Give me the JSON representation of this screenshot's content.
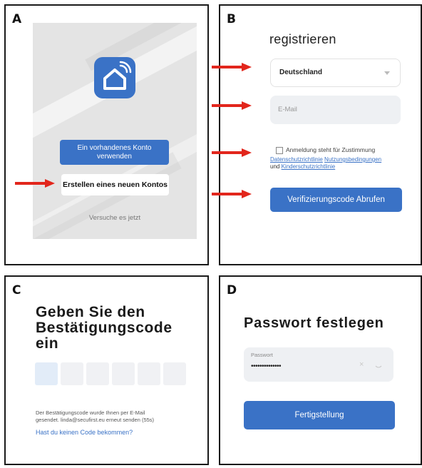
{
  "panels": {
    "a": {
      "label": "A",
      "existing_account_button": [
        "Ein vorhandenes Konto",
        "verwenden"
      ],
      "create_account_button": "Erstellen eines neuen Kontos",
      "try_now_link": "Versuche es jetzt"
    },
    "b": {
      "label": "B",
      "title": "registrieren",
      "country_select": "Deutschland",
      "email_placeholder": "E-Mail",
      "consent_text": "Anmeldung steht für Zustimmung",
      "privacy_link": "Datenschutzrichtlinie",
      "terms_link": "Nutzungsbedingungen",
      "and_text": "und",
      "child_privacy_link": "Kinderschutzrichtlinie",
      "get_code_button": "Verifizierungscode Abrufen"
    },
    "c": {
      "label": "C",
      "title": [
        "Geben Sie den",
        "Bestätigungscode",
        "ein"
      ],
      "code_box_count": 6,
      "info_text": [
        "Der Bestätigungscode wurde Ihnen per E-Mail",
        "gesendet. linda@secufirst.eu erneut senden (55s)"
      ],
      "no_code_link": "Hast du keinen Code bekommen?"
    },
    "d": {
      "label": "D",
      "title": "Passwort festlegen",
      "password_label": "Passwort",
      "password_value": "••••••••••••••",
      "finish_button": "Fertigstellung"
    }
  },
  "colors": {
    "accent_blue": "#3a72c6",
    "arrow_red": "#e2261c",
    "panel_border": "#1a1a1a"
  },
  "icons": {
    "arrow": "red-arrow-icon",
    "app": "smart-home-icon",
    "clear": "clear-icon",
    "visibility": "eye-closed-icon",
    "dropdown": "chevron-down-icon"
  }
}
